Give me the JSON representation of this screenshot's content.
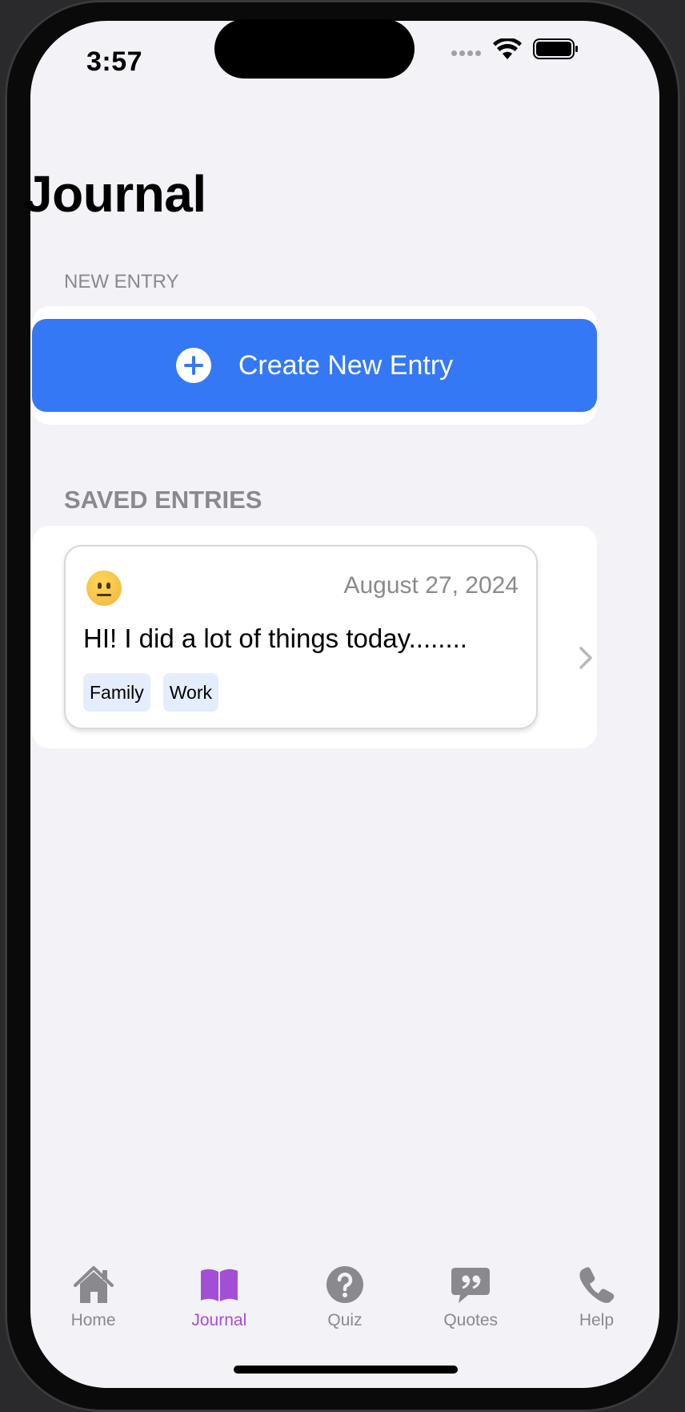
{
  "status_bar": {
    "time": "3:57"
  },
  "page": {
    "title": "Journal"
  },
  "new_entry": {
    "section_label": "NEW ENTRY",
    "button_label": "Create New Entry",
    "button_icon": "plus-circle-icon",
    "accent_color": "#3478f6"
  },
  "saved_entries": {
    "section_label": "SAVED ENTRIES",
    "items": [
      {
        "mood_icon": "neutral-face-emoji",
        "date": "August 27, 2024",
        "text": "HI! I did a lot of things today........",
        "tags": [
          "Family",
          "Work"
        ]
      }
    ]
  },
  "tab_bar": {
    "active_color": "#a24fd6",
    "tabs": [
      {
        "label": "Home",
        "icon": "house-icon",
        "active": false
      },
      {
        "label": "Journal",
        "icon": "book-icon",
        "active": true
      },
      {
        "label": "Quiz",
        "icon": "question-circle-icon",
        "active": false
      },
      {
        "label": "Quotes",
        "icon": "quote-bubble-icon",
        "active": false
      },
      {
        "label": "Help",
        "icon": "phone-icon",
        "active": false
      }
    ]
  }
}
